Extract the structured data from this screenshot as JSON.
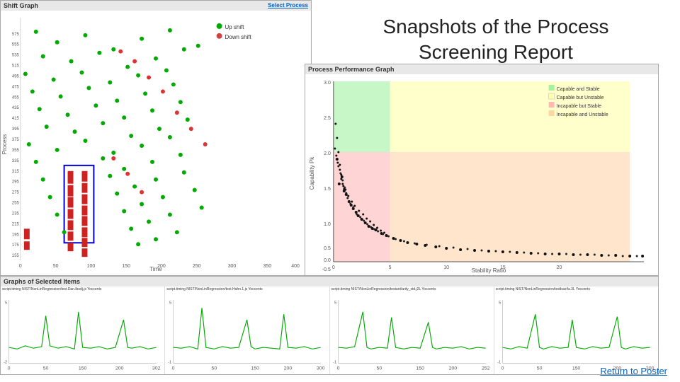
{
  "title": {
    "line1": "Snapshots of the Process",
    "line2": "Screening Report"
  },
  "shift_graph": {
    "title": "Shift Graph",
    "select_process_label": "Select Process",
    "legend": {
      "up_shift": "Up shift",
      "down_shift": "Down shift"
    },
    "x_axis_label": "Time",
    "y_axis_label": "Process"
  },
  "perf_graph": {
    "title": "Process Performance Graph",
    "x_axis_label": "Stability Ratio",
    "y_axis_label": "Capability Pk",
    "legend": [
      "Capable and Stable",
      "Capable but Unstable",
      "Incapable but Stable",
      "Incapable and Unstable"
    ]
  },
  "selected_graphs": {
    "title": "Graphs of Selected Items",
    "graphs": [
      {
        "label": "script.timing NIST/NonLinRegression/test.Dan.lbodj.js Yoccents"
      },
      {
        "label": "script.timing NIST/NonLinRegression/test.Hahn.1.js Yoccents"
      },
      {
        "label": "script.timing NIST/NonLinRegression/testant/arity_std.j2L Yoccents"
      },
      {
        "label": "script.timing NIST/NonLinRegression/testbas4a.3L Yoccents"
      }
    ]
  },
  "return_link": {
    "label": "Return to Poster"
  }
}
